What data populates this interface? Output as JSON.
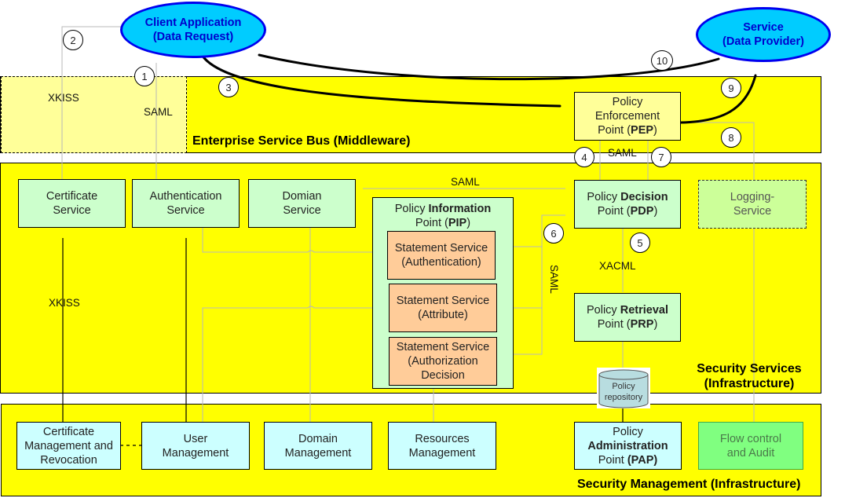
{
  "actors": {
    "client": {
      "line1": "Client Application",
      "line2": "(Data Request)"
    },
    "service": {
      "line1": "Service",
      "line2": "(Data Provider)"
    }
  },
  "layers": {
    "esb": {
      "title": "Enterprise Service Bus (Middleware)"
    },
    "security_services": {
      "title_line1": "Security Services",
      "title_line2": "(Infrastructure)"
    },
    "security_management": {
      "title": "Security Management (Infrastructure)"
    }
  },
  "esb_region": {
    "xkiss_label": "XKISS",
    "saml_label": "SAML"
  },
  "pep": {
    "line1": "Policy",
    "line2": "Enforcement",
    "line3_prefix": "Point (",
    "line3_bold": "PEP",
    "line3_suffix": ")"
  },
  "services": {
    "certificate": {
      "line1": "Certificate",
      "line2": "Service"
    },
    "authentication": {
      "line1": "Authentication",
      "line2": "Service"
    },
    "domain": {
      "line1": "Domian",
      "line2": "Service"
    },
    "pip": {
      "line1_prefix": "Policy ",
      "line1_bold": "Information",
      "line2_prefix": "Point (",
      "line2_bold": "PIP",
      "line2_suffix": ")"
    },
    "statements": [
      {
        "line1": "Statement Service",
        "line2": "(Authentication)",
        "line3": ""
      },
      {
        "line1": "Statement Service",
        "line2": "(Attribute)",
        "line3": ""
      },
      {
        "line1": "Statement Service",
        "line2": "(Authorization",
        "line3": "Decision"
      }
    ],
    "pdp": {
      "line1_prefix": "Policy ",
      "line1_bold": "Decision",
      "line2_prefix": "Point (",
      "line2_bold": "PDP",
      "line2_suffix": ")"
    },
    "prp": {
      "line1_prefix": "Policy ",
      "line1_bold": "Retrieval",
      "line2_prefix": "Point (",
      "line2_bold": "PRP",
      "line2_suffix": ")"
    },
    "logging": {
      "line1": "Logging-",
      "line2": "Service"
    },
    "repository": {
      "line1": "Policy",
      "line2": "repository"
    }
  },
  "management": {
    "certificate": {
      "line1": "Certificate",
      "line2": "Management and",
      "line3": "Revocation"
    },
    "user": {
      "line1": "User",
      "line2": "Management"
    },
    "domain": {
      "line1": "Domain",
      "line2": "Management"
    },
    "resources": {
      "line1": "Resources",
      "line2": "Management"
    },
    "pap": {
      "line1": "Policy",
      "line2": "Administration",
      "line3_prefix": "Point ",
      "line3_bold": "(PAP)"
    },
    "flow": {
      "line1": "Flow control",
      "line2": "and Audit"
    }
  },
  "protocol_labels": {
    "saml_pep_pdp": "SAML",
    "saml_top": "SAML",
    "saml_vertical": "SAML",
    "xacml": "XACML",
    "xkiss": "XKISS"
  },
  "steps": [
    "1",
    "2",
    "3",
    "4",
    "5",
    "6",
    "7",
    "8",
    "9",
    "10"
  ],
  "colors": {
    "layer_yellow": "#ffff00",
    "actor_fill": "#00ccff",
    "actor_border": "#0000ee",
    "service_green": "#ccffcc",
    "management_cyan": "#ccffff",
    "statement_orange": "#ffcc99",
    "flow_green": "#80ff80"
  }
}
